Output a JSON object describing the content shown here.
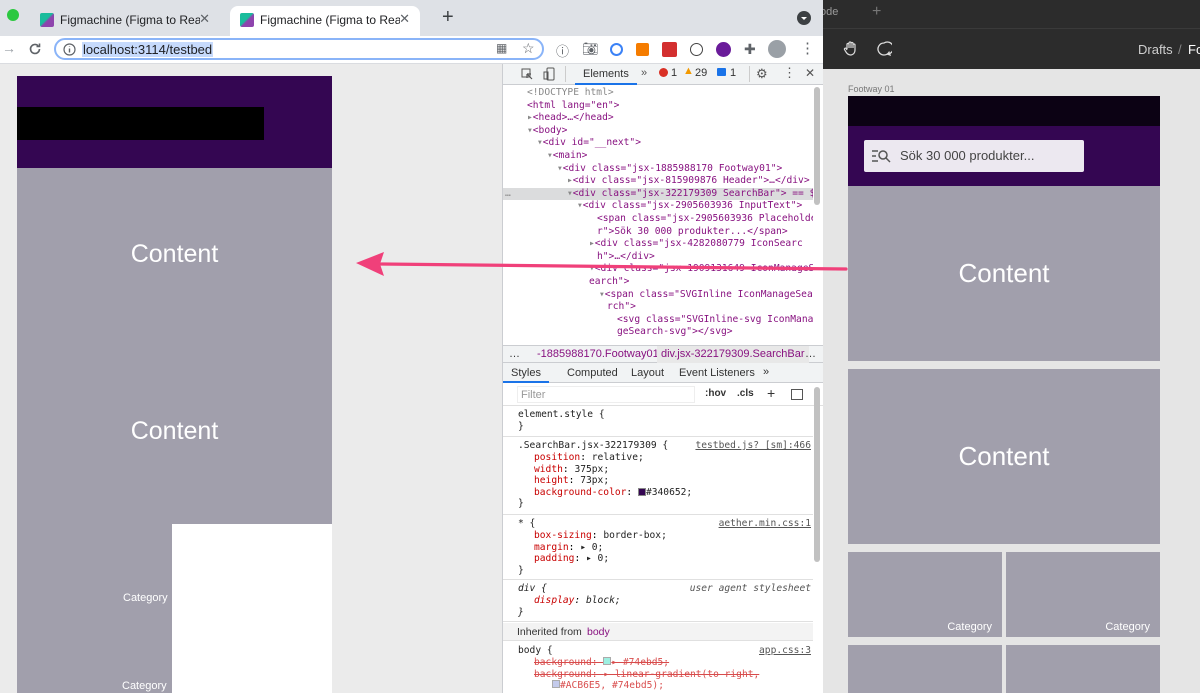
{
  "browser": {
    "tabs": [
      {
        "title": "Figmachine (Figma to React) –",
        "active": false
      },
      {
        "title": "Figmachine (Figma to React) –",
        "active": true
      }
    ],
    "new_tab": "+",
    "url": "localhost:3114/testbed"
  },
  "page": {
    "content_1": "Content",
    "content_2": "Content",
    "category_1": "Category",
    "category_2": "Category"
  },
  "devtools": {
    "tabs": [
      "Elements"
    ],
    "more": "»",
    "errors": "1",
    "warnings": "29",
    "messages": "1",
    "dom": [
      "<!DOCTYPE html>",
      "<html lang=\"en\">",
      "<head>…</head>",
      "<body>",
      "<div id=\"__next\">",
      "<main>",
      "<div class=\"jsx-1885988170 Footway01\">",
      "<div class=\"jsx-815909876 Header\">…</div>",
      "<div class=\"jsx-322179309 SearchBar\"> == $",
      "<div class=\"jsx-2905603936 InputText\">",
      "<span class=\"jsx-2905603936 Placeholde",
      "r\">Sök 30 000 produkter...</span>",
      "<div class=\"jsx-4282080779 IconSearc",
      "h\">…</div>",
      "<div class=\"jsx-1909131649 IconManageS",
      "earch\">",
      "<span class=\"SVGInline IconManageSea",
      "rch\">",
      "<svg class=\"SVGInline-svg IconMana",
      "geSearch-svg\"></svg>"
    ],
    "breadcrumbs": [
      "…",
      "-1885988170.Footway01",
      "div.jsx-322179309.SearchBar",
      "…"
    ],
    "style_tabs": [
      "Styles",
      "Computed",
      "Layout",
      "Event Listeners",
      "»"
    ],
    "filter_placeholder": "Filter",
    "hov": ":hov",
    "cls": ".cls",
    "rules": {
      "element_style": "element.style {",
      "close": "}",
      "searchbar_selector": ".SearchBar.jsx-322179309 {",
      "searchbar_src": "testbed.js? [sm]:466",
      "searchbar_props": [
        {
          "p": "position",
          "v": "relative;"
        },
        {
          "p": "width",
          "v": "375px;"
        },
        {
          "p": "height",
          "v": "73px;"
        },
        {
          "p": "background-color",
          "v": "#340652;"
        }
      ],
      "star_selector": "* {",
      "star_src": "aether.min.css:1",
      "star_props": [
        {
          "p": "box-sizing",
          "v": "border-box;"
        },
        {
          "p": "margin",
          "v": "▸ 0;"
        },
        {
          "p": "padding",
          "v": "▸ 0;"
        }
      ],
      "div_selector": "div {",
      "div_src": "user agent stylesheet",
      "div_prop": {
        "p": "display",
        "v": "block;"
      },
      "inherited_label": "Inherited from",
      "inherited_from": "body",
      "body_selector": "body {",
      "body_src": "app.css:3",
      "body_props": [
        {
          "p": "background",
          "v": "▸ #74ebd5;"
        },
        {
          "p": "background",
          "v": "▸ linear-gradient(to right,"
        }
      ],
      "body_grad": "#ACB6E5, #74ebd5);"
    }
  },
  "figma": {
    "tab_text": "ode",
    "new_tab": "+",
    "crumb_drafts": "Drafts",
    "crumb_sep": "/",
    "crumb_next": "Fo",
    "frame_label": "Footway 01",
    "search_placeholder": "Sök 30 000 produkter...",
    "content_1": "Content",
    "content_2": "Content",
    "category_1": "Category",
    "category_2": "Category"
  },
  "colors": {
    "header_purple": "#340652",
    "content_gray": "#a19fac",
    "arrow_pink": "#f0407a"
  }
}
